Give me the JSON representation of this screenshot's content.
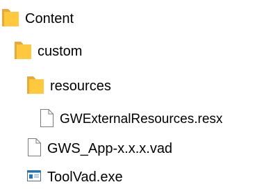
{
  "tree": {
    "items": [
      {
        "label": "Content",
        "icon": "folder-icon",
        "depth": 0
      },
      {
        "label": "custom",
        "icon": "folder-icon",
        "depth": 1
      },
      {
        "label": "resources",
        "icon": "folder-icon",
        "depth": 2
      },
      {
        "label": "GWExternalResources.resx",
        "icon": "file-icon",
        "depth": 3
      },
      {
        "label": "GWS_App-x.x.x.vad",
        "icon": "file-icon",
        "depth": 2
      },
      {
        "label": "ToolVad.exe",
        "icon": "exe-icon",
        "depth": 2
      }
    ]
  },
  "colors": {
    "folder_body": "#FFC83D",
    "folder_tab": "#E8A93B",
    "file_border": "#7A7A7A",
    "exe_blue": "#1E72C8"
  }
}
